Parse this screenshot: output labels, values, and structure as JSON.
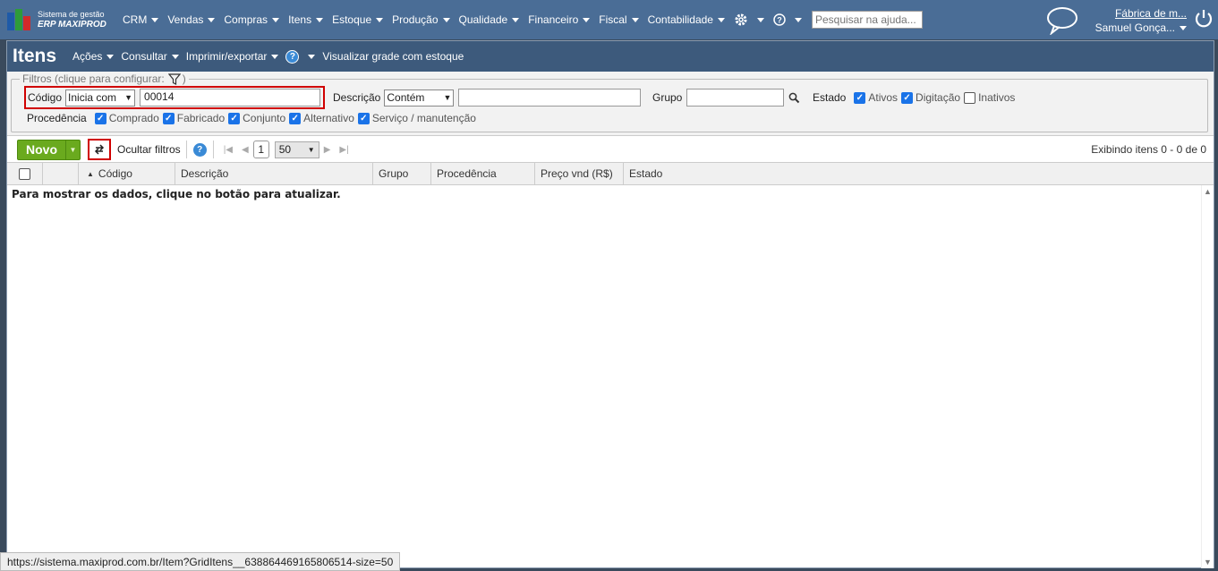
{
  "brand": {
    "line1": "Sistema de gestão",
    "line2": "ERP MAXIPROD"
  },
  "nav": {
    "items": [
      "CRM",
      "Vendas",
      "Compras",
      "Itens",
      "Estoque",
      "Produção",
      "Qualidade",
      "Financeiro",
      "Fiscal",
      "Contabilidade"
    ],
    "search_placeholder": "Pesquisar na ajuda..."
  },
  "user": {
    "company": "Fábrica de m...",
    "name": "Samuel Gonça..."
  },
  "page": {
    "title": "Itens",
    "menu": {
      "acoes": "Ações",
      "consultar": "Consultar",
      "imprimir": "Imprimir/exportar",
      "grade": "Visualizar grade com estoque"
    }
  },
  "filters": {
    "legend": "Filtros (clique para configurar:",
    "legend_end": ")",
    "codigo_label": "Código",
    "codigo_mode": "Inicia com",
    "codigo_value": "00014",
    "descricao_label": "Descrição",
    "descricao_mode": "Contém",
    "descricao_value": "",
    "grupo_label": "Grupo",
    "grupo_value": "",
    "estado_label": "Estado",
    "estado_options": [
      {
        "label": "Ativos",
        "checked": true
      },
      {
        "label": "Digitação",
        "checked": true
      },
      {
        "label": "Inativos",
        "checked": false
      }
    ],
    "procedencia_label": "Procedência",
    "procedencia_options": [
      {
        "label": "Comprado",
        "checked": true
      },
      {
        "label": "Fabricado",
        "checked": true
      },
      {
        "label": "Conjunto",
        "checked": true
      },
      {
        "label": "Alternativo",
        "checked": true
      },
      {
        "label": "Serviço / manutenção",
        "checked": true
      }
    ]
  },
  "toolbar": {
    "novo": "Novo",
    "hide_filters": "Ocultar filtros",
    "page": "1",
    "page_size": "50",
    "count_text": "Exibindo itens 0 - 0 de 0"
  },
  "grid": {
    "columns": [
      "Código",
      "Descrição",
      "Grupo",
      "Procedência",
      "Preço vnd (R$)",
      "Estado"
    ],
    "empty_message": "Para mostrar os dados, clique no botão para atualizar."
  },
  "status_url": "https://sistema.maxiprod.com.br/Item?GridItens__638864469165806514-size=50",
  "colors": {
    "topbar": "#4a6d96",
    "titlebar": "#3d5a7c",
    "accent_green": "#6aaa1e",
    "highlight_red": "#d00000"
  }
}
